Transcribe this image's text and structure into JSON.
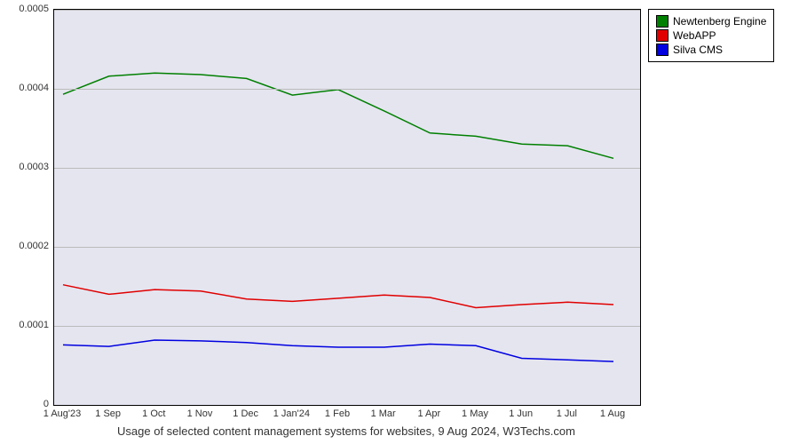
{
  "chart_data": {
    "type": "line",
    "caption": "Usage of selected content management systems for websites, 9 Aug 2024, W3Techs.com",
    "xlabel": "",
    "ylabel": "",
    "ylim": [
      0,
      0.0005
    ],
    "yticks": [
      0,
      0.0001,
      0.0002,
      0.0003,
      0.0004,
      0.0005
    ],
    "ytick_labels": [
      "0",
      "0.0001",
      "0.0002",
      "0.0003",
      "0.0004",
      "0.0005"
    ],
    "categories": [
      "1 Aug'23",
      "1 Sep",
      "1 Oct",
      "1 Nov",
      "1 Dec",
      "1 Jan'24",
      "1 Feb",
      "1 Mar",
      "1 Apr",
      "1 May",
      "1 Jun",
      "1 Jul",
      "1 Aug"
    ],
    "series": [
      {
        "name": "Newtenberg Engine",
        "color": "#008000",
        "values": [
          0.000393,
          0.000416,
          0.00042,
          0.000418,
          0.000413,
          0.000392,
          0.000399,
          0.000372,
          0.000344,
          0.00034,
          0.00033,
          0.000328,
          0.000312
        ]
      },
      {
        "name": "WebAPP",
        "color": "#e00000",
        "values": [
          0.000152,
          0.00014,
          0.000146,
          0.000144,
          0.000134,
          0.000131,
          0.000135,
          0.000139,
          0.000136,
          0.000123,
          0.000127,
          0.00013,
          0.000127
        ]
      },
      {
        "name": "Silva CMS",
        "color": "#0000e0",
        "values": [
          7.6e-05,
          7.4e-05,
          8.2e-05,
          8.1e-05,
          7.9e-05,
          7.5e-05,
          7.3e-05,
          7.3e-05,
          7.7e-05,
          7.5e-05,
          5.9e-05,
          5.7e-05,
          5.5e-05
        ]
      }
    ]
  }
}
